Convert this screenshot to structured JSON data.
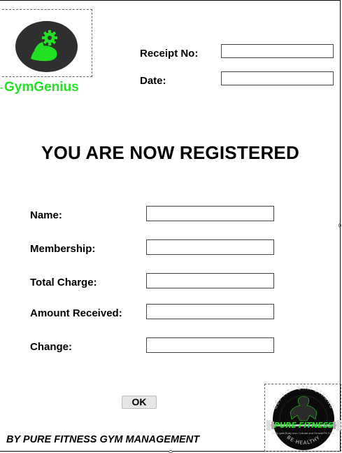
{
  "brand": {
    "name": "GymGenius",
    "accent_color": "#22e022",
    "logo_icon": "flexing-arm-gear-icon"
  },
  "receipt": {
    "receipt_no_label": "Receipt No:",
    "receipt_no_value": "",
    "date_label": "Date:",
    "date_value": ""
  },
  "headline": "YOU ARE NOW REGISTERED",
  "form": {
    "fields": [
      {
        "label": "Name:",
        "value": ""
      },
      {
        "label": "Membership:",
        "value": ""
      },
      {
        "label": "Total Charge:",
        "value": ""
      },
      {
        "label": "Amount Received:",
        "value": ""
      },
      {
        "label": "Change:",
        "value": ""
      }
    ]
  },
  "actions": {
    "ok_label": "OK"
  },
  "footer": {
    "credit": "BY PURE FITNESS GYM MANAGEMENT",
    "badge": {
      "icon": "pure-fitness-badge-icon",
      "title": "PURE FITNESS",
      "arc_top": "GET FIT · STAY STRONG",
      "arc_bottom": "BE HEALTHY",
      "subtext": "Body gain Body loss Cultural and Growth Fit Cardiovascular Training"
    }
  }
}
